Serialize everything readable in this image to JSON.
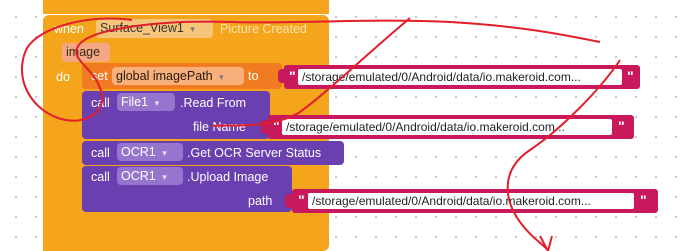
{
  "event": {
    "when": "when",
    "component": "Surface_View1",
    "event_name": "Picture Created",
    "param": "image",
    "do": "do"
  },
  "set_block": {
    "set": "set",
    "variable": "global imagePath",
    "to": "to",
    "value": "/storage/emulated/0/Android/data/io.makeroid.com..."
  },
  "read_block": {
    "call": "call",
    "component": "File1",
    "method": ".Read From",
    "arg_label": "file Name",
    "arg_value": "/storage/emulated/0/Android/data/io.makeroid.com..."
  },
  "ocr_status_block": {
    "call": "call",
    "component": "OCR1",
    "method": ".Get OCR Server Status"
  },
  "upload_block": {
    "call": "call",
    "component": "OCR1",
    "method": ".Upload Image",
    "arg_label": "path",
    "arg_value": "/storage/emulated/0/Android/data/io.makeroid.com..."
  },
  "quote_char": "\"",
  "dropdown_arrow": "▾",
  "colors": {
    "event_orange": "#f4a51c",
    "event_text_chip": "#f7c57a",
    "param_chip": "#f3a883",
    "set_orange": "#f07b21",
    "procedure_purple": "#6a3fb0",
    "string_red": "#c8195c",
    "annotation_red": "#e21f2b"
  }
}
